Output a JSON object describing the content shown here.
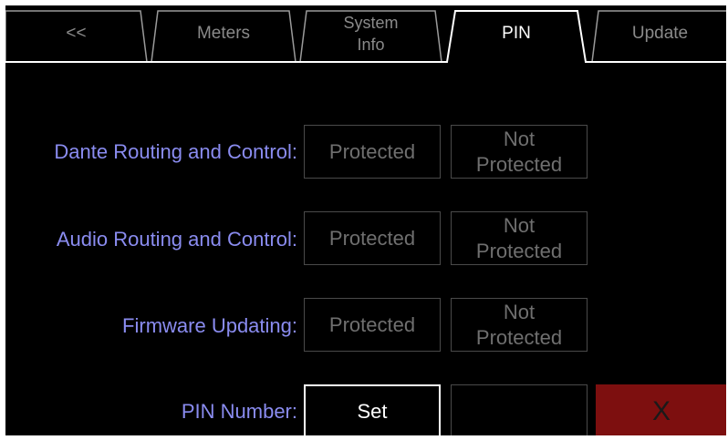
{
  "tabs": [
    {
      "label": "<<",
      "active": false
    },
    {
      "label": "Meters",
      "active": false
    },
    {
      "label": "System\nInfo",
      "active": false
    },
    {
      "label": "PIN",
      "active": true
    },
    {
      "label": "Update",
      "active": false
    }
  ],
  "rows": [
    {
      "label": "Dante Routing and Control:",
      "protected": "Protected",
      "not_protected": "Not\nProtected"
    },
    {
      "label": "Audio Routing and Control:",
      "protected": "Protected",
      "not_protected": "Not\nProtected"
    },
    {
      "label": "Firmware Updating:",
      "protected": "Protected",
      "not_protected": "Not\nProtected"
    }
  ],
  "pin": {
    "label": "PIN Number:",
    "set_label": "Set",
    "value": "",
    "clear_label": "X"
  },
  "colors": {
    "background": "#000000",
    "label_text": "#8a8cf0",
    "disabled_text": "#6f6f6f",
    "clear_button": "#7d0f0f"
  }
}
